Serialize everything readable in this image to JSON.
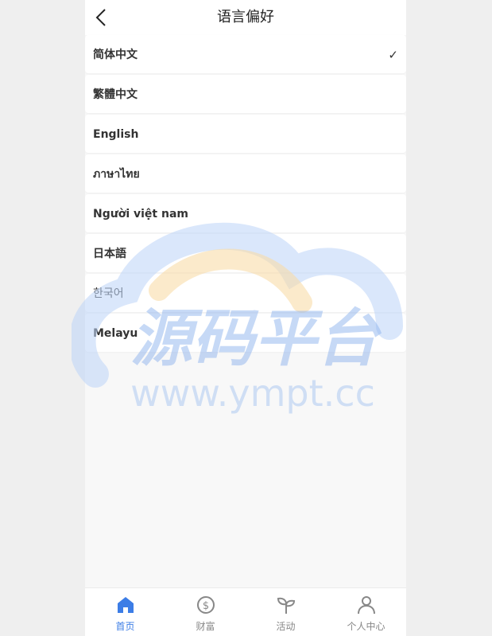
{
  "header": {
    "title": "语言偏好"
  },
  "languages": [
    {
      "label": "简体中文",
      "selected": true
    },
    {
      "label": "繁體中文",
      "selected": false
    },
    {
      "label": "English",
      "selected": false
    },
    {
      "label": "ภาษาไทย",
      "selected": false
    },
    {
      "label": "Người việt nam",
      "selected": false
    },
    {
      "label": "日本語",
      "selected": false
    },
    {
      "label": "한국어",
      "selected": false
    },
    {
      "label": "Melayu",
      "selected": false
    }
  ],
  "check_mark": "✓",
  "watermark": {
    "title": "源码平台",
    "url": "www.ympt.cc"
  },
  "tabbar": {
    "active_color": "#3c7de6",
    "inactive_color": "#888888",
    "items": [
      {
        "label": "首页",
        "icon": "home-icon",
        "active": true
      },
      {
        "label": "财富",
        "icon": "dollar-coin-icon",
        "active": false
      },
      {
        "label": "活动",
        "icon": "sprout-icon",
        "active": false
      },
      {
        "label": "个人中心",
        "icon": "user-icon",
        "active": false
      }
    ]
  }
}
